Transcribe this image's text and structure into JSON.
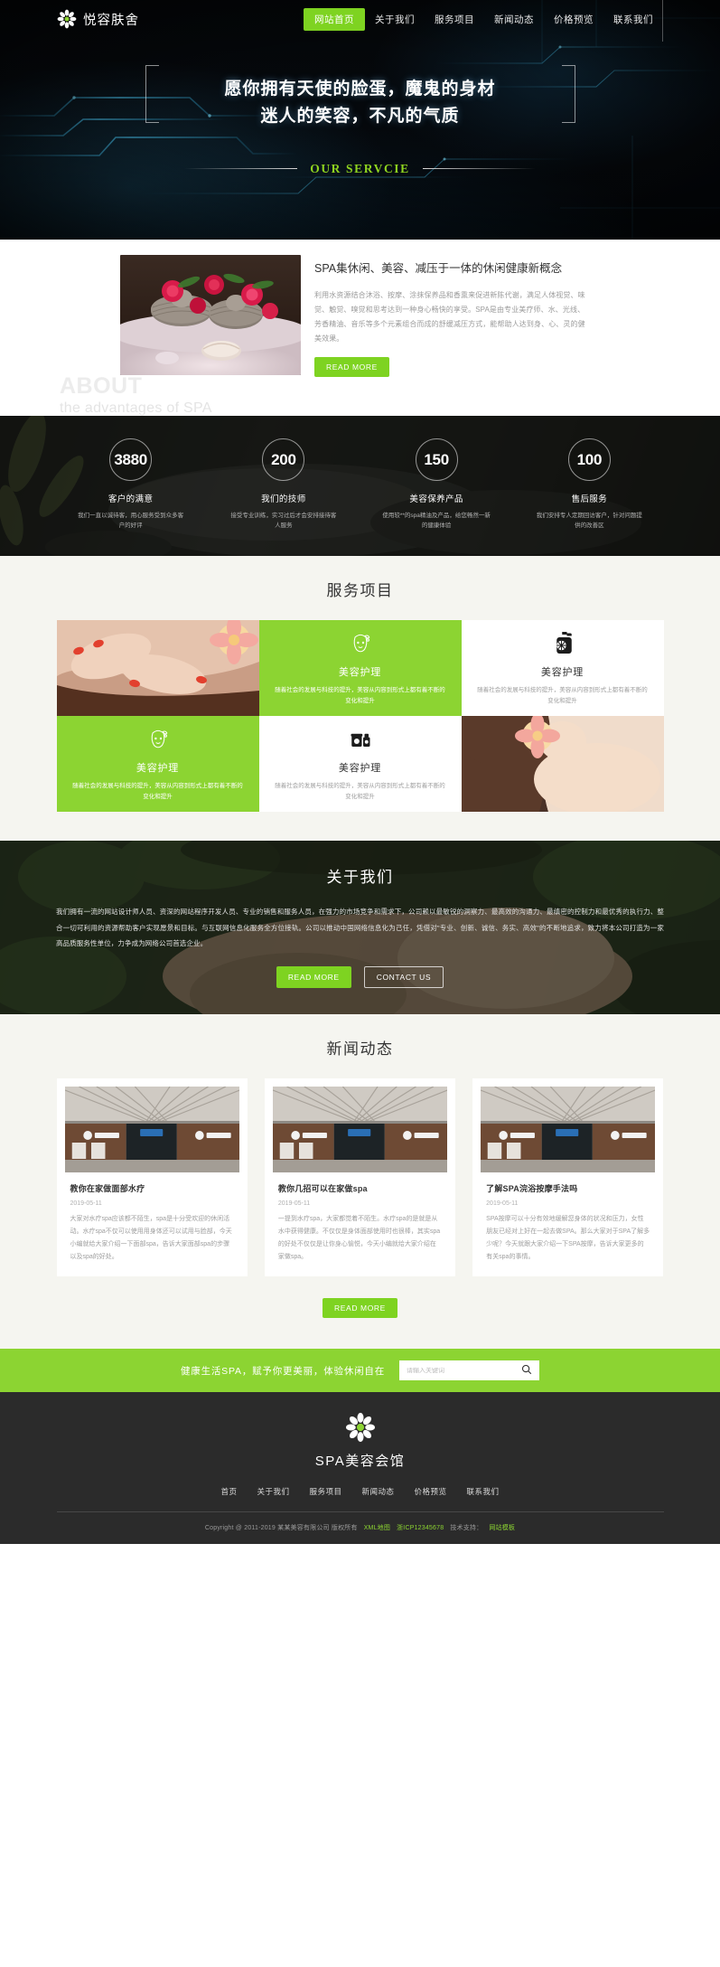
{
  "header": {
    "brand": "悦容肤舍",
    "logo_icon": "flower-icon",
    "nav": [
      {
        "label": "网站首页",
        "active": true
      },
      {
        "label": "关于我们",
        "active": false
      },
      {
        "label": "服务项目",
        "active": false
      },
      {
        "label": "新闻动态",
        "active": false
      },
      {
        "label": "价格预览",
        "active": false
      },
      {
        "label": "联系我们",
        "active": false
      }
    ]
  },
  "hero": {
    "line1": "愿你拥有天使的脸蛋，魔鬼的身材",
    "line2": "迷人的笑容，不凡的气质",
    "subtitle": "OUR SERVCIE",
    "accent_color": "#8fd41f"
  },
  "about": {
    "watermark_big": "ABOUT",
    "watermark_small": "the advantages of SPA",
    "heading": "SPA集休闲、美容、减压于一体的休闲健康新概念",
    "paragraph": "利用水资源结合沐浴、按摩、涂抹保养品和香熏来促进新陈代谢，满足人体视觉、味觉、触觉、嗅觉和思考达到一种身心畅快的享受。SPA是由专业美疗师、水、光线、芳香精油、音乐等多个元素组合而成的舒缓减压方式，能帮助人达到身、心、灵的健美效果。",
    "read_more": "READ MORE"
  },
  "stats": [
    {
      "number": "3880",
      "label": "客户的满意",
      "desc": "我们一直以诚待客，用心服务受到众多客户的好评"
    },
    {
      "number": "200",
      "label": "我们的技师",
      "desc": "接受专业训练，实习过后才会安排接待客人服务"
    },
    {
      "number": "150",
      "label": "美容保养产品",
      "desc": "使用较**的spa精油及产品，给您畅然一新的健康体验"
    },
    {
      "number": "100",
      "label": "售后服务",
      "desc": "我们安排专人定期回访客户，针对问题提供的改善区"
    }
  ],
  "services": {
    "title": "服务项目",
    "cards": [
      {
        "type": "photo",
        "name": "",
        "desc": "",
        "icon": ""
      },
      {
        "type": "green",
        "name": "美容护理",
        "desc": "随着社会的发展与科技的提升，美容从内容到形式上都有着不断的变化和提升",
        "icon": "face-mask-icon"
      },
      {
        "type": "white",
        "name": "美容护理",
        "desc": "随着社会的发展与科技的提升，美容从内容到形式上都有着不断的变化和提升",
        "icon": "lotion-bottle-icon"
      },
      {
        "type": "green",
        "name": "美容护理",
        "desc": "随着社会的发展与科技的提升，美容从内容到形式上都有着不断的变化和提升",
        "icon": "face-mask-icon"
      },
      {
        "type": "white",
        "name": "美容护理",
        "desc": "随着社会的发展与科技的提升，美容从内容到形式上都有着不断的变化和提升",
        "icon": "cosmetic-jar-icon"
      },
      {
        "type": "photo",
        "name": "",
        "desc": "",
        "icon": ""
      }
    ]
  },
  "aboutus": {
    "title": "关于我们",
    "paragraph": "我们拥有一流的网站设计师人员、资深的网站程序开发人员、专业的销售和服务人员，在强力的市场竞争和需求下，公司赖以最敏锐的洞察力、最高效的沟通力、最缜密的控制力和最优秀的执行力、整合一切可利用的资源帮助客户实现愿景和目标。与互联网信息化服务全方位接轨。公司以推动中国网络信息化为己任，凭借对\"专业、创新、诚信、务实、高效\"的不断地追求，致力将本公司打造为一家高品质服务性单位，力争成为网络公司首选企业。",
    "read_more": "READ MORE",
    "contact_us": "CONTACT US"
  },
  "news": {
    "title": "新闻动态",
    "read_more": "READ MORE",
    "items": [
      {
        "title": "教你在家做面部水疗",
        "date": "2019-05-11",
        "text": "大家对水疗spa应该都不陌生，spa是十分受欢迎的休闲活动。水疗spa不仅可以使用用身体还可以试用与脸部，今天小编就给大家介绍一下面部spa，告诉大家面部spa的步骤以及spa的好处。"
      },
      {
        "title": "教你几招可以在家做spa",
        "date": "2019-05-11",
        "text": "一提到水疗spa，大家都觉着不陌生。水疗spa的是就是从水中获得健康。不仅仅是身体面部使用时也很棒，其实spa的好处不仅仅是让你身心愉悦，今天小编就给大家介绍在家做spa。"
      },
      {
        "title": "了解SPA浣浴按摩手法吗",
        "date": "2019-05-11",
        "text": "SPA按摩可以十分有效地缓解您身体的状况和压力，女性朋友已经对上好在一起去做SPA。那么大家对于SPA了解多少呢？今天就跟大家介绍一下SPA按摩，告诉大家更多的有关spa的事情。"
      }
    ]
  },
  "search": {
    "slogan": "健康生活SPA，赋予你更美丽，体验休闲自在",
    "placeholder": "请输入关键词",
    "icon": "search-icon"
  },
  "footer": {
    "logo_icon": "flower-icon",
    "name": "SPA美容会馆",
    "nav": [
      "首页",
      "关于我们",
      "服务项目",
      "新闻动态",
      "价格预览",
      "联系我们"
    ],
    "copyright": "Copyright @ 2011-2019 某某美容有限公司 版权所有",
    "links": [
      {
        "label": "XML地图",
        "color": "#8cd432"
      },
      {
        "label": "浙ICP12345678",
        "color": "#8cd432"
      }
    ],
    "support_label": "技术支持：",
    "support_link": "网站模板"
  },
  "colors": {
    "accent": "#8cd432",
    "dark": "#2b2b2b",
    "hero_accent": "#8fd41f"
  }
}
